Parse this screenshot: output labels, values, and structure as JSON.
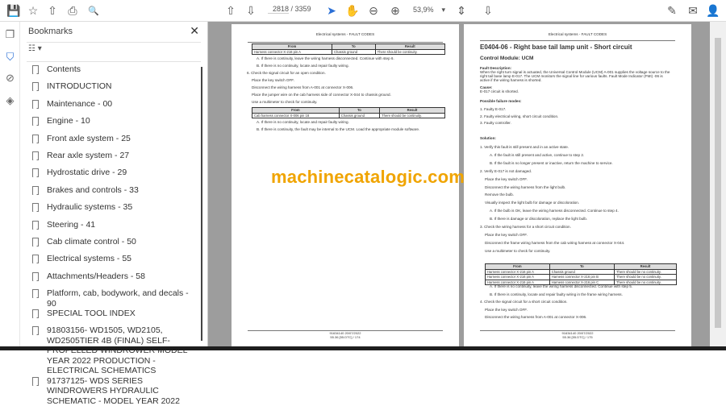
{
  "toolbar": {
    "current_page": "2818",
    "total_pages": "/ 3359",
    "zoom": "53,9%",
    "zoom_caret": "▾"
  },
  "icons": {
    "save": "💾",
    "star": "☆",
    "upload": "⇧",
    "print": "⎙",
    "search": "🔍",
    "prev": "⊕",
    "next": "⊕",
    "cursor": "➤",
    "hand": "✋",
    "zoom_out": "⊖",
    "zoom_in": "⊕",
    "fit": "⇕",
    "scroll": "⇩",
    "sign": "✎",
    "mail": "✉",
    "user": "👤",
    "close": "✕",
    "pages": "❐",
    "bookmark": "🔖",
    "attach": "📎",
    "layers": "◈",
    "options": "☷ ▾"
  },
  "panel": {
    "title": "Bookmarks",
    "items": [
      "Contents",
      "INTRODUCTION",
      "Maintenance - 00",
      "Engine - 10",
      "Front axle system - 25",
      "Rear axle system - 27",
      "Hydrostatic drive - 29",
      "Brakes and controls - 33",
      "Hydraulic systems - 35",
      "Steering - 41",
      "Cab climate control - 50",
      "Electrical systems - 55",
      "Attachments/Headers - 58",
      "Platform, cab, bodywork, and decals - 90",
      "SPECIAL TOOL INDEX",
      "91803156- WD1505, WD2105, WD2505TIER 4B (FINAL) SELF-PROPELLED WINDROWER MODEL YEAR 2022 PRODUCTION - ELECTRICAL SCHEMATICS",
      "91737125- WDS SERIES WINDROWERS HYDRAULIC SCHEMATIC - MODEL YEAR 2022"
    ]
  },
  "left_page": {
    "header": "Electrical systems - FAULT CODES",
    "table1": {
      "headers": [
        "From",
        "To",
        "Result"
      ],
      "rows": [
        [
          "Harness connector X-216 pin A",
          "Chassis ground",
          "There should be continuity."
        ]
      ]
    },
    "lines1": [
      "A.  If there is continuity, leave the wiring harness disconnected. Continue with step 6.",
      "B.  If there is no continuity, locate and repair faulty wiring.",
      "6.  Check the signal circuit for an open condition.",
      "Place the key switch OFF.",
      "Disconnect the wiring harness from A-001 at connector X-006.",
      "Place the jumper wire on the cab harness side of connector X-044 to chassis ground.",
      "Use a multimeter to check for continuity."
    ],
    "table2": {
      "headers": [
        "From",
        "To",
        "Result"
      ],
      "rows": [
        [
          "Cab harness connector X-006 pin 18",
          "Chassis ground",
          "There should be continuity."
        ]
      ]
    },
    "lines2": [
      "A.  If there is no continuity, locate and repair faulty wiring.",
      "B.  If there is continuity, the fault may be internal to the UCM. Load the appropriate module software."
    ],
    "footer1": "91634140 20/07/2022",
    "footer2": "55.36 [55.DTC] / 174"
  },
  "watermark": "machinecatalogic.com",
  "right_page": {
    "header": "Electrical systems - FAULT CODES",
    "title": "E0404-06 - Right base tail lamp unit - Short circuit",
    "subtitle": "Control Module: UCM",
    "fault_label": "Fault Description:",
    "fault_text": [
      "When the right turn signal is actuated, the Universal Control Module (UCM) A-001 supplies the voltage source to the",
      "right tail base lamp E-017.  The UCM monitors the signal line for various faults.  Fault Mode Indicator (FMI) -06 is",
      "active if the wiring harness is shorted."
    ],
    "cause_label": "Cause:",
    "cause_text": "E-017 circuit is shorted.",
    "modes_label": "Possible failure modes:",
    "modes": [
      "1.  Faulty E-017.",
      "2.  Faulty electrical wiring, short circuit condition.",
      "3.  Faulty controller."
    ],
    "solution_label": "Solution:",
    "steps": [
      "1.  Verify this fault is still present and in an active state.",
      "A.  If the fault is still present and active, continue to step 2.",
      "B.  If the fault is no longer present or inactive, return the machine to service.",
      "2.  Verify E-017 is not damaged.",
      "Place the key switch OFF.",
      "Disconnect the wiring harness from the light bulb.",
      "Remove the bulb.",
      "Visually inspect the light bulb for damage or discoloration.",
      "A.  If the bulb is OK, leave the wiring harness disconnected. Continue to step 4.",
      "B.  If there is damage or discoloration, replace the light bulb.",
      "3.  Check the wiring harness for a short circuit condition.",
      "Place the key switch OFF.",
      "Disconnect the frame wiring harness from the cab wiring harness at connector X-044.",
      "Use a multimeter to check for continuity."
    ],
    "table": {
      "headers": [
        "From",
        "To",
        "Result"
      ],
      "rows": [
        [
          "Harness connector X-216 pin A",
          "Chassis ground",
          "There should be no continuity."
        ],
        [
          "Harness connector X-216 pin A",
          "Harness connector X-216 pin B",
          "There should be no continuity."
        ],
        [
          "Harness connector X-216 pin A",
          "Harness connector X-216 pin C",
          "There should be no continuity."
        ]
      ]
    },
    "steps2": [
      "A.  If there is no continuity, leave the wiring harness disconnected. Continue with step 5.",
      "B.  If there is continuity, locate and repair faulty wiring in the frame wiring harness.",
      "4.  Check the signal circuit for a short circuit condition.",
      "Place the key switch OFF.",
      "Disconnect the wiring harness from A-001 at connector X-006."
    ],
    "footer1": "91634140 20/07/2022",
    "footer2": "55.36 [55.DTC] / 175"
  }
}
